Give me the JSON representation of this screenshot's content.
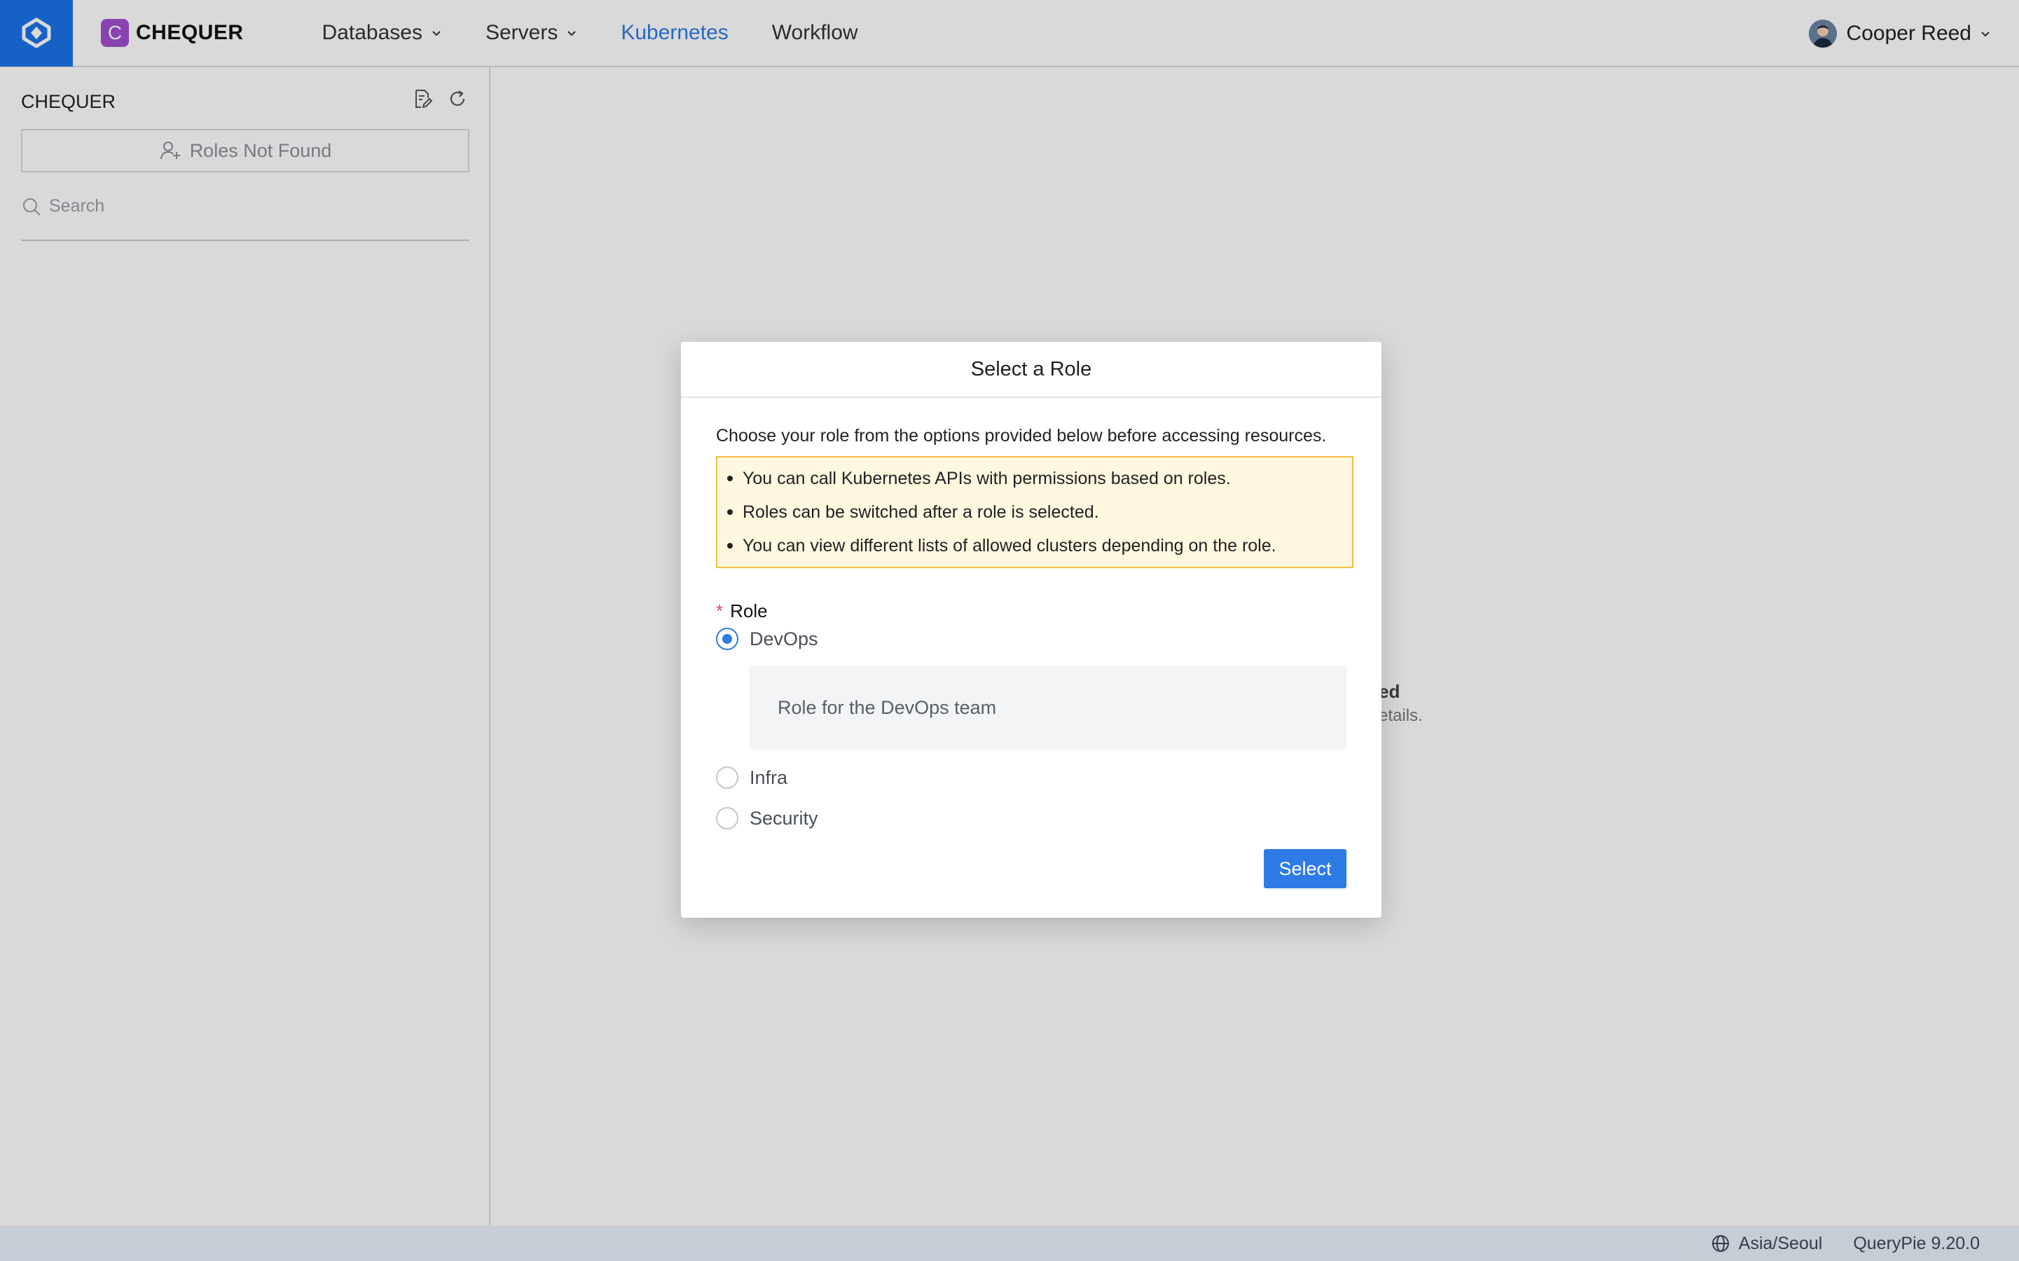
{
  "topbar": {
    "brand_initial": "C",
    "brand_name": "CHEQUER",
    "nav": [
      {
        "label": "Databases",
        "has_dropdown": true
      },
      {
        "label": "Servers",
        "has_dropdown": true
      },
      {
        "label": "Kubernetes",
        "active": true
      },
      {
        "label": "Workflow"
      }
    ],
    "user_name": "Cooper Reed"
  },
  "sidebar": {
    "title": "CHEQUER",
    "roles_button": "Roles Not Found",
    "search_placeholder": "Search"
  },
  "main": {
    "empty_title_partial": "ed",
    "empty_desc_partial": "etails."
  },
  "modal": {
    "title": "Select a Role",
    "intro": "Choose your role from the options provided below before accessing resources.",
    "notices": [
      "You can call Kubernetes APIs with permissions based on roles.",
      "Roles can be switched after a role is selected.",
      "You can view different lists of allowed clusters depending on the role."
    ],
    "field_label": "Role",
    "required_mark": "*",
    "options": [
      {
        "label": "DevOps",
        "selected": true,
        "description": "Role for the DevOps team"
      },
      {
        "label": "Infra",
        "selected": false
      },
      {
        "label": "Security",
        "selected": false
      }
    ],
    "select_button": "Select"
  },
  "footer": {
    "timezone": "Asia/Seoul",
    "version": "QueryPie 9.20.0"
  },
  "colors": {
    "accent": "#2f7be5",
    "logo_bg": "#1a73e8",
    "brand_badge": "#a14fd0",
    "notice_border": "#f0c040",
    "notice_bg": "#fff7e0",
    "footer_bg": "#e9f1fb"
  }
}
